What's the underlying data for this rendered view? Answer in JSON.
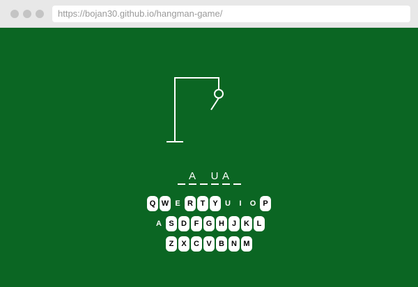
{
  "browser": {
    "url": "https://bojan30.github.io/hangman-game/"
  },
  "game": {
    "word_slots": [
      "",
      "A",
      "",
      "U",
      "A",
      ""
    ],
    "keyboard_rows": [
      [
        {
          "letter": "Q",
          "used": false
        },
        {
          "letter": "W",
          "used": false
        },
        {
          "letter": "E",
          "used": true
        },
        {
          "letter": "R",
          "used": false
        },
        {
          "letter": "T",
          "used": false
        },
        {
          "letter": "Y",
          "used": false
        },
        {
          "letter": "U",
          "used": true
        },
        {
          "letter": "I",
          "used": true
        },
        {
          "letter": "O",
          "used": true
        },
        {
          "letter": "P",
          "used": false
        }
      ],
      [
        {
          "letter": "A",
          "used": true
        },
        {
          "letter": "S",
          "used": false
        },
        {
          "letter": "D",
          "used": false
        },
        {
          "letter": "F",
          "used": false
        },
        {
          "letter": "G",
          "used": false
        },
        {
          "letter": "H",
          "used": false
        },
        {
          "letter": "J",
          "used": false
        },
        {
          "letter": "K",
          "used": false
        },
        {
          "letter": "L",
          "used": false
        }
      ],
      [
        {
          "letter": "Z",
          "used": false
        },
        {
          "letter": "X",
          "used": false
        },
        {
          "letter": "C",
          "used": false
        },
        {
          "letter": "V",
          "used": false
        },
        {
          "letter": "B",
          "used": false
        },
        {
          "letter": "N",
          "used": false
        },
        {
          "letter": "M",
          "used": false
        }
      ]
    ],
    "hangman_parts_shown": [
      "base",
      "pole",
      "beam",
      "rope",
      "head",
      "body"
    ]
  },
  "colors": {
    "background": "#0b6623",
    "key": "#ffffff",
    "line": "#ffffff"
  }
}
